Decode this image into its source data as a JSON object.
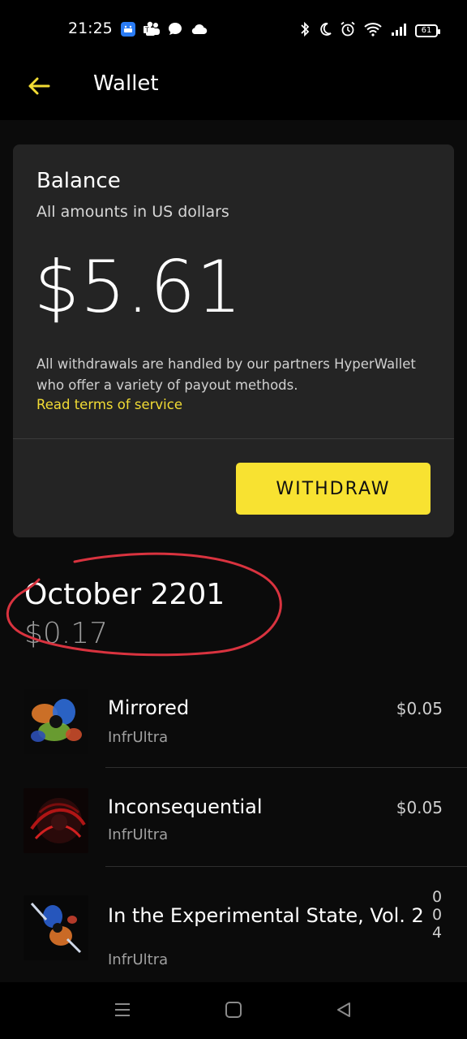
{
  "status_bar": {
    "time": "21:25",
    "battery": "61",
    "left_icons": [
      "app-icon",
      "teams-icon",
      "chat-icon",
      "cloud-icon"
    ],
    "right_icons": [
      "bluetooth-icon",
      "moon-icon",
      "alarm-icon",
      "wifi-icon",
      "signal-icon",
      "battery-icon"
    ]
  },
  "app_bar": {
    "title": "Wallet",
    "back_icon": "arrow-left-icon",
    "accent": "#F2DC34"
  },
  "balance_card": {
    "title": "Balance",
    "subtitle": "All amounts in US dollars",
    "amount": "$5.61",
    "note": "All withdrawals are handled by our partners HyperWallet who offer a variety of payout methods.",
    "terms_link": "Read terms of service",
    "withdraw_label": "WITHDRAW",
    "button_color": "#F8E231"
  },
  "month": {
    "title": "October 2201",
    "total": "$0.17",
    "annotation_color": "#D9333F"
  },
  "tracks": [
    {
      "name": "Mirrored",
      "artist": "InfrUltra",
      "price": "$0.05"
    },
    {
      "name": "Inconsequential",
      "artist": "InfrUltra",
      "price": "$0.05"
    },
    {
      "name": "In the Experimental State, Vol. 2",
      "artist": "InfrUltra",
      "price": "004"
    }
  ],
  "nav_bar": {
    "icons": [
      "menu-icon",
      "home-square-icon",
      "back-triangle-icon"
    ]
  }
}
